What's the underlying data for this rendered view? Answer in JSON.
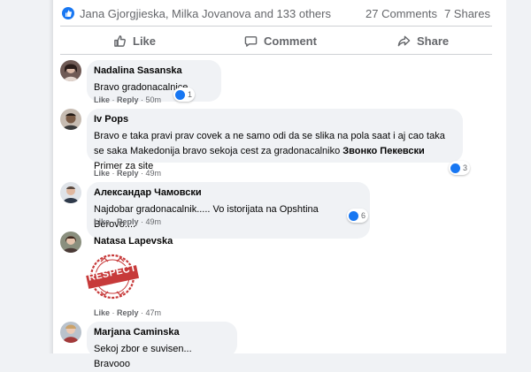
{
  "post_stats": {
    "likers": "Jana Gjorgjieska, Milka Jovanova and 133 others",
    "comments": "27 Comments",
    "shares": "7 Shares"
  },
  "actions": {
    "like": "Like",
    "comment": "Comment",
    "share": "Share"
  },
  "comments": [
    {
      "author": "Nadalina Sasanska",
      "text": "Bravo gradonacalnice",
      "like": "Like",
      "reply": "Reply",
      "time": "50m",
      "reactions": "1"
    },
    {
      "author": "Iv Pops",
      "text_before": "Bravo e taka pravi prav covek a ne samo odi da se slika na pola saat i aj cao taka se saka Makedonija bravo sekoja cest za gradonacalniko ",
      "mention": "Звонко Пекевски",
      "text_after": " Primer za site",
      "like": "Like",
      "reply": "Reply",
      "time": "49m",
      "reactions": "3"
    },
    {
      "author": "Александар Чамовски",
      "text": "Najdobar gradonacalnik..... Vo istorijata na Opshtina Berovo....",
      "like": "Like",
      "reply": "Reply",
      "time": "49m",
      "reactions": "6"
    },
    {
      "author": "Natasa Lapevska",
      "sticker": "RESPECT",
      "like": "Like",
      "reply": "Reply",
      "time": "47m"
    },
    {
      "author": "Marjana Caminska",
      "text": "Sekoj zbor e suvisen... Bravooo"
    }
  ],
  "colors": {
    "accent": "#1877f2",
    "bubble": "#f0f2f5",
    "muted": "#65676b",
    "sticker_red": "#c73a3a"
  },
  "icons": [
    "like-icon",
    "comment-icon",
    "share-icon",
    "reaction-like-icon"
  ]
}
